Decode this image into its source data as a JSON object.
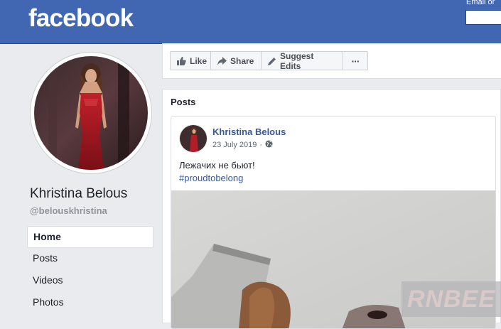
{
  "header": {
    "logo_text": "facebook",
    "login_label": "Email or"
  },
  "profile": {
    "name": "Khristina Belous",
    "handle": "@belouskhristina"
  },
  "nav": {
    "items": [
      {
        "label": "Home",
        "active": true
      },
      {
        "label": "Posts",
        "active": false
      },
      {
        "label": "Videos",
        "active": false
      },
      {
        "label": "Photos",
        "active": false
      }
    ]
  },
  "actions": {
    "like_label": "Like",
    "share_label": "Share",
    "suggest_label": "Suggest Edits",
    "more_label": "···"
  },
  "posts": {
    "heading": "Posts",
    "post": {
      "author": "Khristina Belous",
      "date": "23 July 2019",
      "separator": "·",
      "audience_icon": "globe-icon",
      "text": "Лежачих не бьют!",
      "hashtag": "#proudtobelong"
    }
  },
  "watermark": "RNBEE",
  "colors": {
    "brand": "#4267b2",
    "link": "#365899",
    "background": "#e9ebee"
  }
}
